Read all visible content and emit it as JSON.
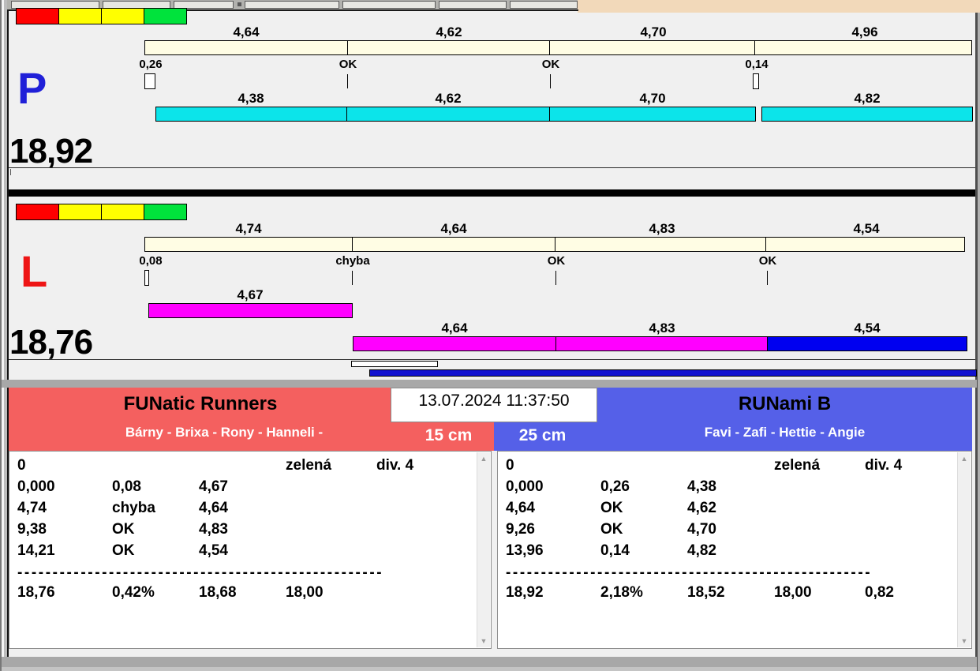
{
  "colors": {
    "lights": [
      "#ff0000",
      "#ffff00",
      "#ffff00",
      "#00e33c"
    ],
    "ideal_bar": "#fffde4",
    "p_actual_bar": "#0ce4ea",
    "l_actual_bar": "#ff00ff",
    "l_last_bar": "#0000f0",
    "progress_bar": "#1212d0",
    "p_letter": "#2020d8",
    "l_letter": "#ee1515",
    "team_left_bg": "#f4605f",
    "team_right_bg": "#5560e8"
  },
  "lane_p": {
    "label": "P",
    "total": "18,92",
    "ideal": [
      "4,64",
      "4,62",
      "4,70",
      "4,96"
    ],
    "marks": [
      "0,26",
      "OK",
      "OK",
      "0,14"
    ],
    "actual": [
      "4,38",
      "4,62",
      "4,70",
      "4,82"
    ]
  },
  "lane_l": {
    "label": "L",
    "total": "18,76",
    "ideal": [
      "4,74",
      "4,64",
      "4,83",
      "4,54"
    ],
    "marks": [
      "0,08",
      "chyba",
      "OK",
      "OK"
    ],
    "leg1": "4,67",
    "actual": [
      "4,64",
      "4,83",
      "4,54"
    ]
  },
  "datetime": "13.07.2024 11:37:50",
  "left_team": {
    "name": "FUNatic Runners",
    "members": "Bárny - Brixa - Rony - Hanneli -",
    "category": "15 cm",
    "rows": [
      [
        "0",
        "",
        "",
        "zelená",
        "div. 4"
      ],
      [
        "0,000",
        "0,08",
        "4,67",
        "",
        ""
      ],
      [
        "4,74",
        "chyba",
        "4,64",
        "",
        ""
      ],
      [
        "9,38",
        "OK",
        "4,83",
        "",
        ""
      ],
      [
        "14,21",
        "OK",
        "4,54",
        "",
        ""
      ]
    ],
    "separator": "----------------------------------------------------",
    "summary": [
      "18,76",
      "0,42%",
      "18,68",
      "18,00"
    ]
  },
  "right_team": {
    "name": "RUNami B",
    "members": "Favi - Zafi - Hettie - Angie",
    "category": "25 cm",
    "rows": [
      [
        "0",
        "",
        "",
        "zelená",
        "div. 4"
      ],
      [
        "0,000",
        "0,26",
        "4,38",
        "",
        ""
      ],
      [
        "4,64",
        "OK",
        "4,62",
        "",
        ""
      ],
      [
        "9,26",
        "OK",
        "4,70",
        "",
        ""
      ],
      [
        "13,96",
        "0,14",
        "4,82",
        "",
        ""
      ]
    ],
    "separator": "----------------------------------------------------",
    "summary": [
      "18,92",
      "2,18%",
      "18,52",
      "18,00",
      "0,82"
    ]
  }
}
